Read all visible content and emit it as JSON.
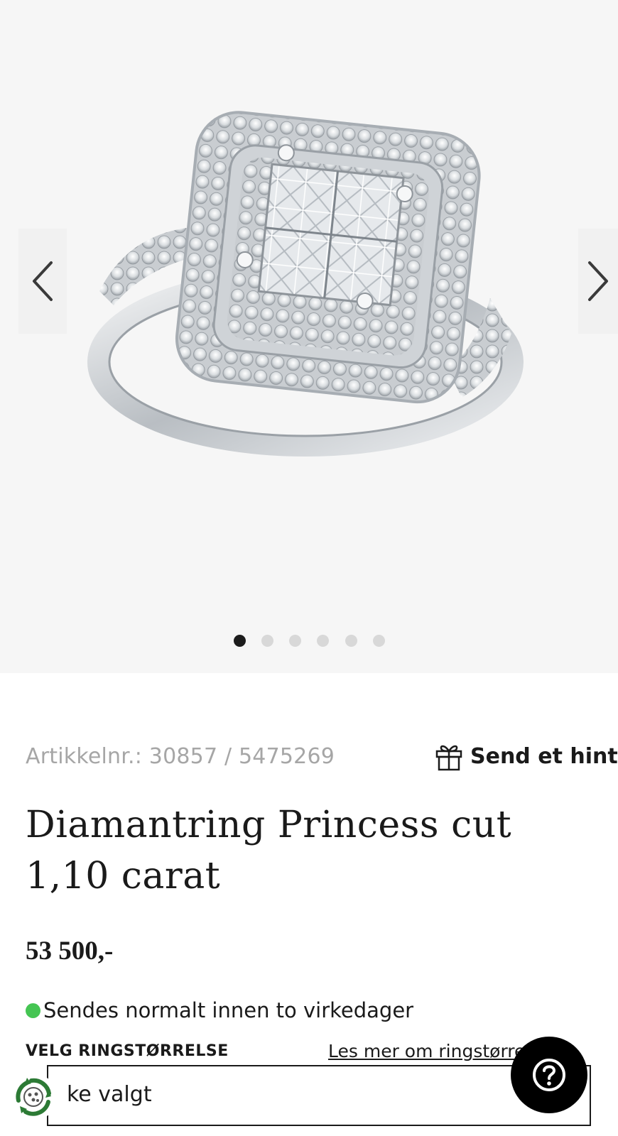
{
  "gallery": {
    "image_alt": "Diamantring Princess cut 1,10 carat",
    "slide_count": 6,
    "active_slide": 1
  },
  "product": {
    "sku_text": "Artikkelnr.: 30857 / 5475269",
    "hint_label": "Send et hint",
    "title": "Diamantring Princess cut 1,10 carat",
    "price": "53 500,-",
    "stock_text": "Sendes normalt innen to virkedager",
    "stock_color": "#45c553"
  },
  "ring_size": {
    "label": "VELG RINGSTØRRELSE",
    "link_text": "Les mer om ringstørrelser",
    "selected_value": "ke valgt"
  },
  "icons": {
    "prev": "chevron-left-icon",
    "next": "chevron-right-icon",
    "gift": "gift-icon",
    "help": "question-mark-icon",
    "eco": "recycle-badge-icon"
  }
}
